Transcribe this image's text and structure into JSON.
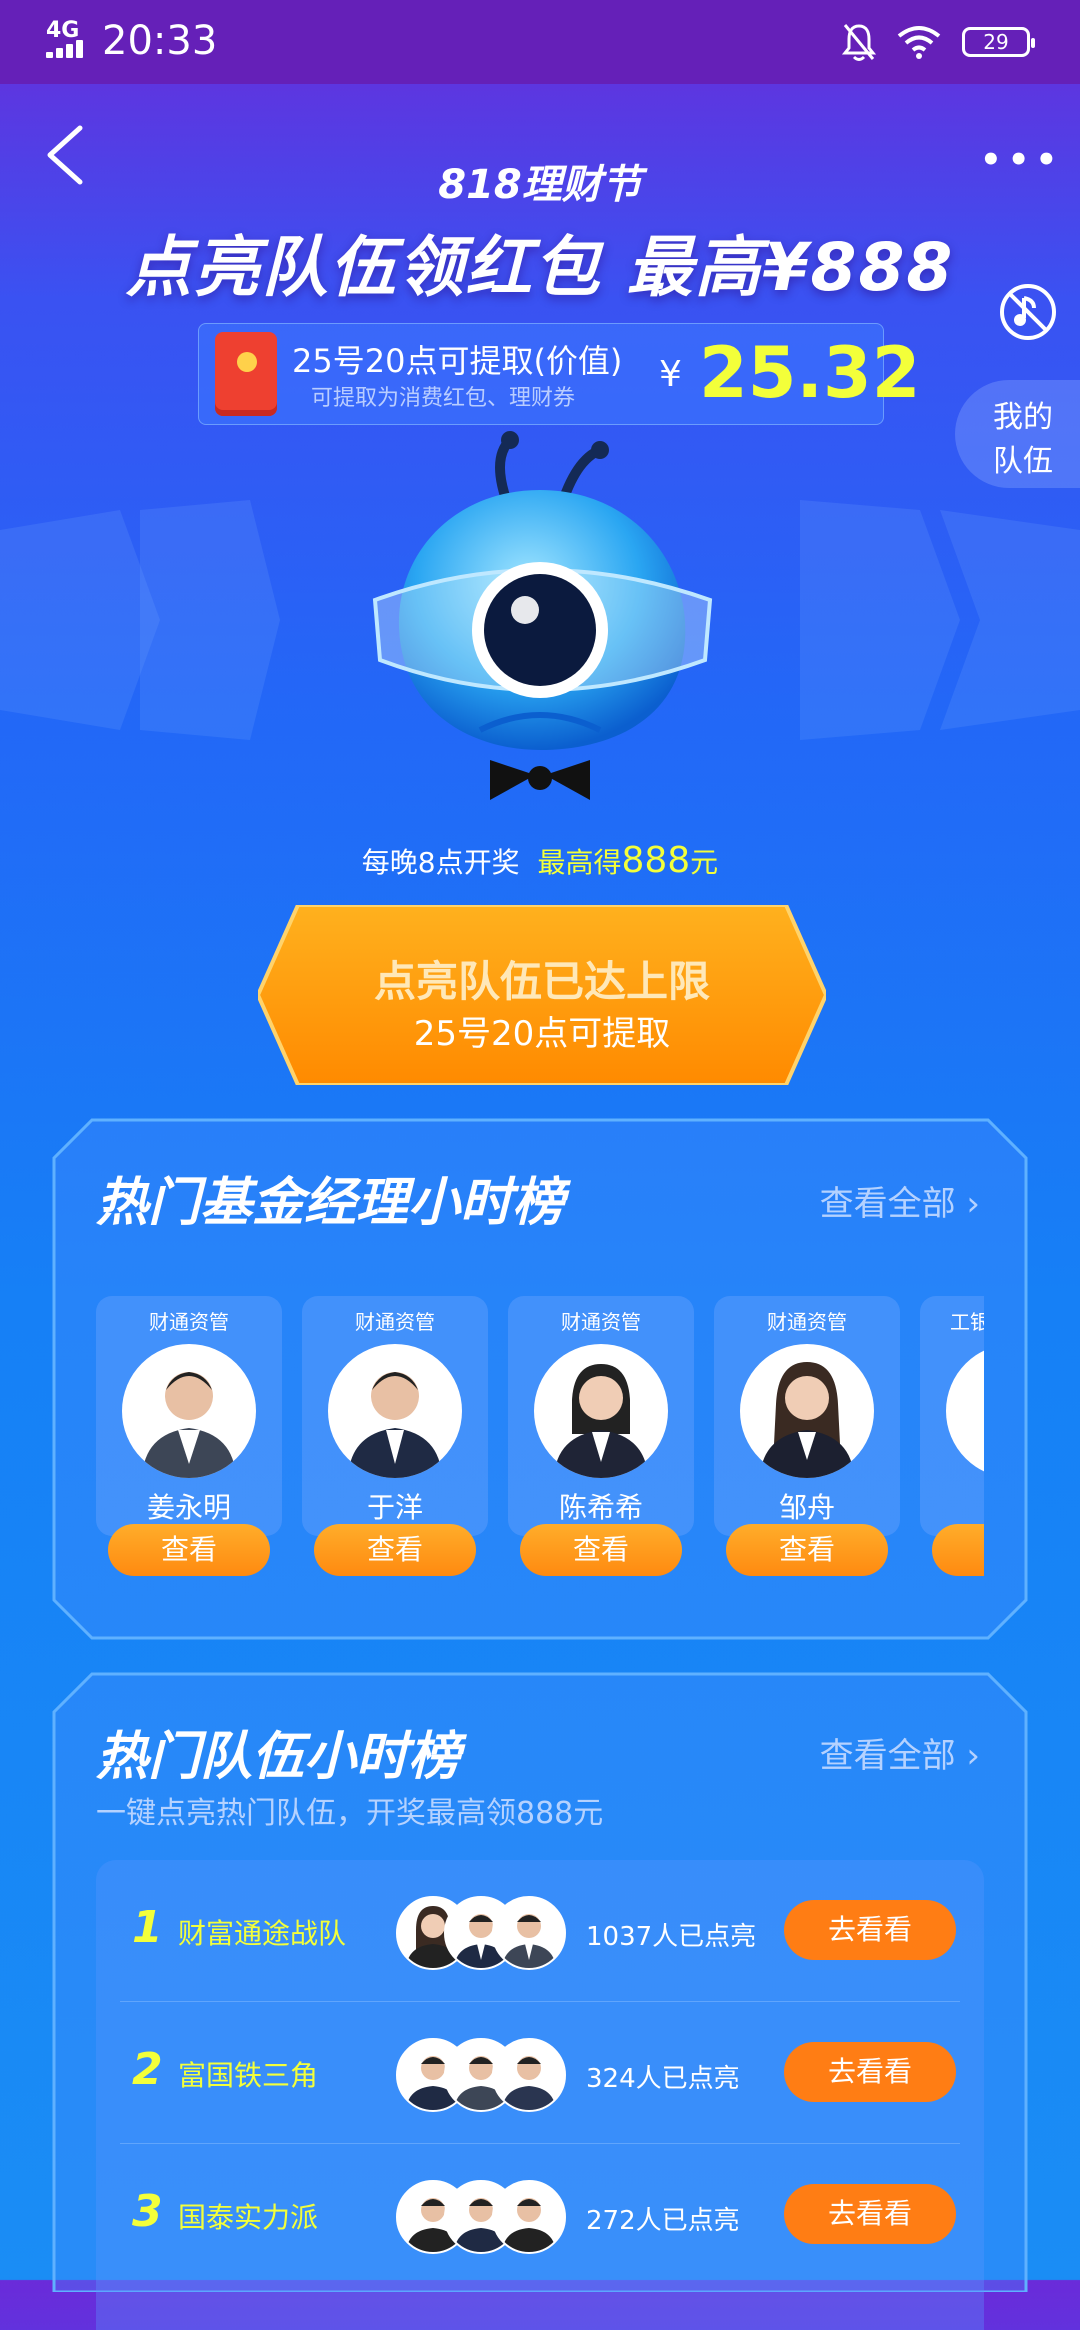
{
  "status_bar": {
    "network": "4G",
    "time": "20:33",
    "battery": "29"
  },
  "header": {
    "subtitle": "818理财节",
    "title": "点亮队伍领红包 最高¥888",
    "my_team_line1": "我的",
    "my_team_line2": "队伍"
  },
  "prize": {
    "line1": "25号20点可提取(价值)",
    "line2": "可提取为消费红包、理财券",
    "currency": "¥",
    "amount": "25.32"
  },
  "draw_note": {
    "prefix": "每晚8点开奖",
    "highlight": "最高得",
    "value": "888",
    "unit": "元"
  },
  "cta": {
    "label": "点亮队伍已达上限",
    "sub": "25号20点可提取"
  },
  "managers_panel": {
    "title": "热门基金经理小时榜",
    "view_all": "查看全部",
    "managers": [
      {
        "firm": "财通资管",
        "name": "姜永明",
        "action": "查看"
      },
      {
        "firm": "财通资管",
        "name": "于洋",
        "action": "查看"
      },
      {
        "firm": "财通资管",
        "name": "陈希希",
        "action": "查看"
      },
      {
        "firm": "财通资管",
        "name": "邹舟",
        "action": "查看"
      },
      {
        "firm": "工银",
        "name": "",
        "action": ""
      }
    ]
  },
  "teams_panel": {
    "title": "热门队伍小时榜",
    "subtitle": "一键点亮热门队伍，开奖最高领888元",
    "view_all": "查看全部",
    "teams": [
      {
        "rank": "1",
        "name": "财富通途战队",
        "lit": "1037人已点亮",
        "action": "去看看"
      },
      {
        "rank": "2",
        "name": "富国铁三角",
        "lit": "324人已点亮",
        "action": "去看看"
      },
      {
        "rank": "3",
        "name": "国泰实力派",
        "lit": "272人已点亮",
        "action": "去看看"
      }
    ]
  },
  "colors": {
    "accent_yellow": "#f3ff3a",
    "orange": "#ff7d14",
    "status_bar": "#6520b8"
  }
}
